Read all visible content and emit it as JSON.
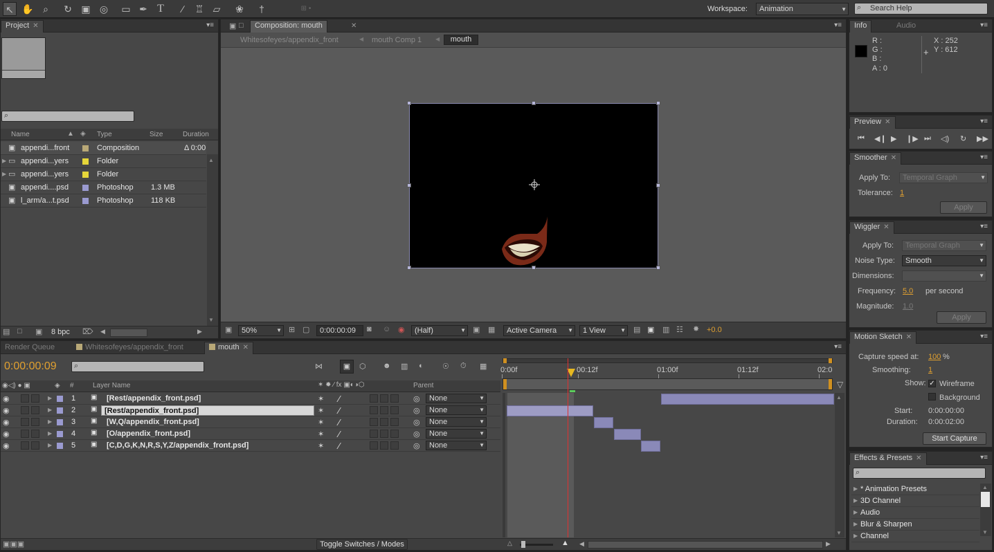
{
  "toolbar": {
    "tools": [
      "selection-tool-icon",
      "hand-tool-icon",
      "zoom-tool-icon",
      "rotate-tool-icon",
      "camera-orbit-icon",
      "pan-behind-icon",
      "rectangle-tool-icon",
      "pen-tool-icon",
      "type-tool-icon",
      "brush-tool-icon",
      "clone-stamp-icon",
      "eraser-icon",
      "roto-brush-icon",
      "puppet-pin-icon"
    ],
    "workspace_label": "Workspace:",
    "workspace_value": "Animation",
    "search_help": "Search Help"
  },
  "project": {
    "tab": "Project",
    "columns": {
      "name": "Name",
      "type": "Type",
      "size": "Size",
      "duration": "Duration"
    },
    "items": [
      {
        "name": "appendi...front",
        "type": "Composition",
        "size": "",
        "duration": "Δ 0:00",
        "color": "#b8a877",
        "icon": "composition-icon"
      },
      {
        "name": "appendi...yers",
        "type": "Folder",
        "size": "",
        "duration": "",
        "color": "#e6d63a",
        "icon": "folder-icon"
      },
      {
        "name": "appendi...yers",
        "type": "Folder",
        "size": "",
        "duration": "",
        "color": "#e6d63a",
        "icon": "folder-icon"
      },
      {
        "name": "appendi....psd",
        "type": "Photoshop",
        "size": "1.3 MB",
        "duration": "",
        "color": "#9a9ad0",
        "icon": "photoshop-file-icon"
      },
      {
        "name": "l_arm/a...t.psd",
        "type": "Photoshop",
        "size": "118 KB",
        "duration": "",
        "color": "#9a9ad0",
        "icon": "photoshop-file-icon"
      }
    ],
    "bpc": "8 bpc"
  },
  "composition": {
    "tab": "Composition: mouth",
    "breadcrumbs": [
      "Whitesofeyes/appendix_front",
      "mouth Comp 1",
      "mouth"
    ],
    "zoom": "50%",
    "timecode": "0:00:00:09",
    "resolution": "(Half)",
    "camera": "Active Camera",
    "view": "1 View",
    "exposure": "+0.0"
  },
  "info": {
    "tabs": [
      "Info",
      "Audio"
    ],
    "r": "R :",
    "g": "G :",
    "b": "B :",
    "a": "A : 0",
    "x": "X : 252",
    "y": "Y : 612"
  },
  "preview": {
    "tab": "Preview"
  },
  "smoother": {
    "tab": "Smoother",
    "apply_to_label": "Apply To:",
    "apply_to_value": "Temporal Graph",
    "tolerance_label": "Tolerance:",
    "tolerance_value": "1",
    "apply_button": "Apply"
  },
  "wiggler": {
    "tab": "Wiggler",
    "apply_to_label": "Apply To:",
    "apply_to_value": "Temporal Graph",
    "noise_label": "Noise Type:",
    "noise_value": "Smooth",
    "dimensions_label": "Dimensions:",
    "frequency_label": "Frequency:",
    "frequency_value": "5.0",
    "per_second": "per second",
    "magnitude_label": "Magnitude:",
    "magnitude_value": "1.0",
    "apply_button": "Apply"
  },
  "motion_sketch": {
    "tab": "Motion Sketch",
    "capture_label": "Capture speed at:",
    "capture_value": "100",
    "capture_unit": "%",
    "smoothing_label": "Smoothing:",
    "smoothing_value": "1",
    "show_label": "Show:",
    "wireframe": "Wireframe",
    "background": "Background",
    "start_label": "Start:",
    "start_value": "0:00:00:00",
    "duration_label": "Duration:",
    "duration_value": "0:00:02:00",
    "start_button": "Start Capture"
  },
  "effects": {
    "tab": "Effects & Presets",
    "items": [
      "* Animation Presets",
      "3D Channel",
      "Audio",
      "Blur & Sharpen",
      "Channel"
    ]
  },
  "timeline": {
    "tabs": [
      "Render Queue",
      "Whitesofeyes/appendix_front",
      "mouth"
    ],
    "timecode": "0:00:00:09",
    "col_num": "#",
    "col_layer": "Layer Name",
    "col_parent": "Parent",
    "ruler": [
      "0:00f",
      "00:12f",
      "01:00f",
      "01:12f",
      "02:0"
    ],
    "layers": [
      {
        "num": "1",
        "name": "[Rest/appendix_front.psd]",
        "parent": "None",
        "selected": false
      },
      {
        "num": "2",
        "name": "[Rest/appendix_front.psd]",
        "parent": "None",
        "selected": true
      },
      {
        "num": "3",
        "name": "[W,Q/appendix_front.psd]",
        "parent": "None",
        "selected": false
      },
      {
        "num": "4",
        "name": "[O/appendix_front.psd]",
        "parent": "None",
        "selected": false
      },
      {
        "num": "5",
        "name": "[C,D,G,K,N,R,S,Y,Z/appendix_front.psd]",
        "parent": "None",
        "selected": false
      }
    ],
    "toggle_label": "Toggle Switches / Modes"
  }
}
